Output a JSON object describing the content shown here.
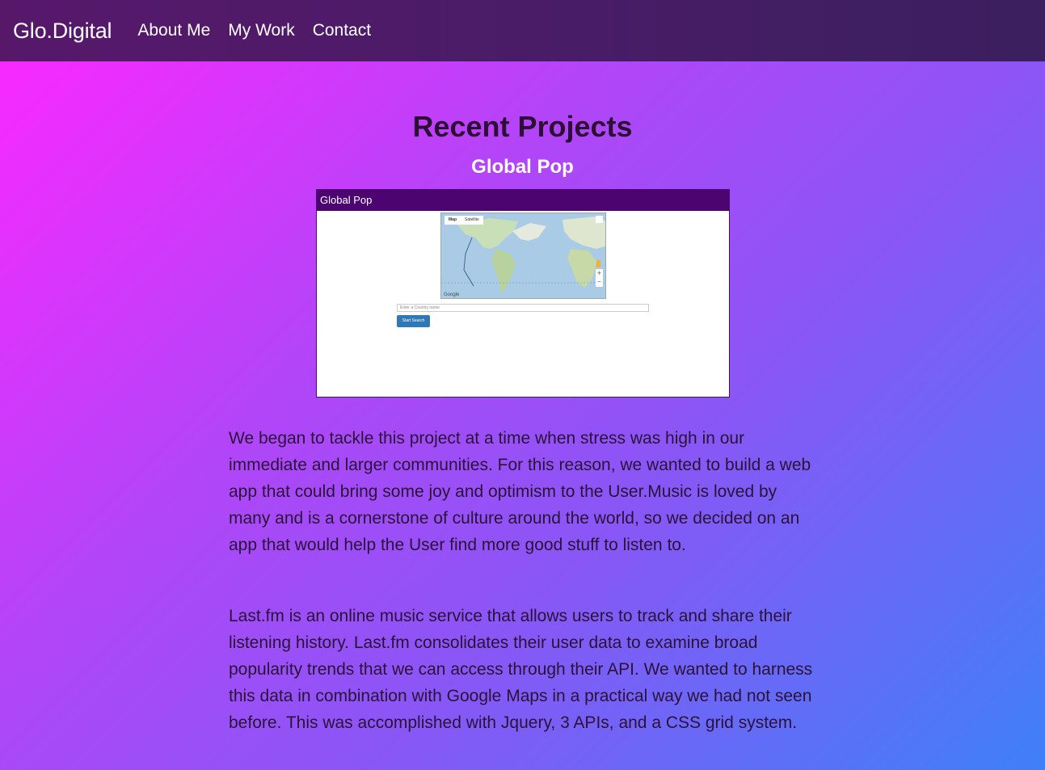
{
  "nav": {
    "brand": "Glo.Digital",
    "links": [
      "About Me",
      "My Work",
      "Contact"
    ]
  },
  "main": {
    "title": "Recent Projects",
    "project": {
      "title": "Global Pop",
      "screenshot": {
        "window_title": "Global Pop",
        "map_tabs": [
          "Map",
          "Satellite"
        ],
        "input_placeholder": "Enter a Country name",
        "button_label": "Start Search",
        "map_logo": "Google"
      },
      "paragraphs": [
        "We began to tackle this project at a time when stress was high in our immediate and larger communities. For this reason, we wanted to build a web app that could bring some joy and optimism to the User.Music is loved by many and is a cornerstone of culture around the world, so we decided on an app that would help the User find more good stuff to listen to.",
        "Last.fm is an online music service that allows users to track and share their listening history. Last.fm consolidates their user data to examine broad popularity trends that we can access through their API. We wanted to harness this data in combination with Google Maps in a practical way we had not seen before. This was accomplished with Jquery, 3 APIs, and a CSS grid system."
      ]
    }
  },
  "colors": {
    "navbar": "#4a1c68",
    "gradient_start": "#ff26ff",
    "gradient_end": "#3f80f8",
    "title_text": "#2d0f35",
    "project_title": "#ffffff"
  }
}
